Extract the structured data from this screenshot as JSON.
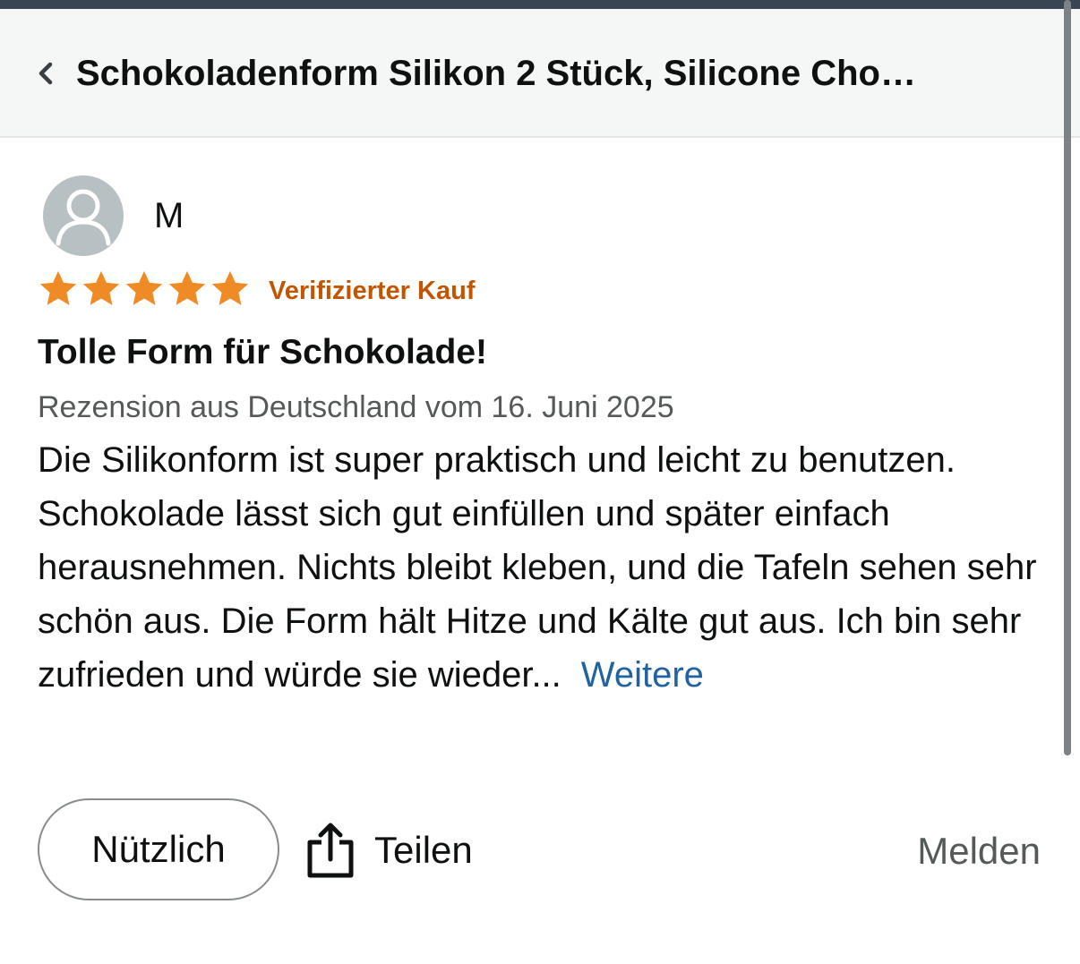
{
  "header": {
    "back_icon": "chevron-left-icon",
    "title": "Schokoladenform Silikon 2 Stück, Silicone Cho…"
  },
  "review": {
    "reviewer_name": "M",
    "avatar_icon": "user-silhouette-icon",
    "rating": 5,
    "rating_max": 5,
    "verified_label": "Verifizierter Kauf",
    "title": "Tolle Form für Schokolade!",
    "meta": "Rezension aus Deutschland vom 16. Juni 2025",
    "body": "Die Silikonform ist super praktisch und leicht zu benutzen. Schokolade lässt sich gut einfüllen und später einfach herausnehmen. Nichts bleibt kleben, und die Tafeln sehen sehr schön aus. Die Form hält Hitze und Kälte gut aus. Ich bin sehr zufrieden und würde sie wieder...",
    "more_label": "Weitere"
  },
  "actions": {
    "helpful_label": "Nützlich",
    "share_label": "Teilen",
    "share_icon": "share-icon",
    "report_label": "Melden"
  },
  "colors": {
    "star": "#f08a24",
    "verified": "#c45500",
    "link": "#2162a1",
    "meta_text": "#565959",
    "header_bg": "#f5f6f6",
    "topbar": "#3a4553"
  }
}
